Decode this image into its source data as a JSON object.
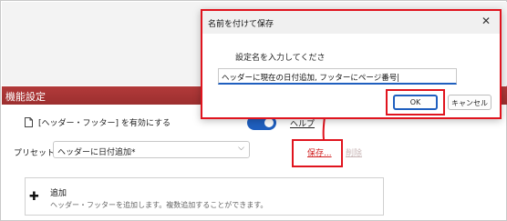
{
  "colors": {
    "accent": "#1f5fbf",
    "section_bar": "#9c2f2f",
    "highlight": "#e0141e",
    "link_red": "#d01f1f"
  },
  "background": {
    "section_title": "機能設定",
    "enable_label": "[ヘッダー・フッター] を有効にする",
    "help_link": "ヘルプ",
    "preset_label": "プリセット：",
    "preset_value": "ヘッダーに日付追加*",
    "save_link": "保存...",
    "delete_link": "削除",
    "add_title": "追加",
    "add_desc": "ヘッダー・フッターを追加します。複数追加することができます。"
  },
  "dialog": {
    "title": "名前を付けて保存",
    "prompt": "設定名を入力してくださ",
    "input_value": "ヘッダーに現在の日付追加, フッターにページ番号|",
    "ok_label": "OK",
    "cancel_label": "キャンセル"
  },
  "icons": {
    "doc": "document-icon",
    "plus": "plus-icon",
    "close": "close-icon",
    "chevron": "chevron-down-icon",
    "arrow": "annotation-arrow"
  }
}
